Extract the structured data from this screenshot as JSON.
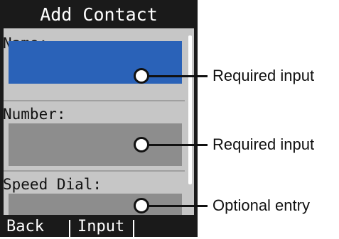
{
  "title": "Add Contact",
  "fields": [
    {
      "label": "Name:",
      "value": ""
    },
    {
      "label": "Number:",
      "value": ""
    },
    {
      "label": "Speed Dial:",
      "value": ""
    }
  ],
  "softkeys": {
    "back": "Back",
    "input": "Input",
    "third": ""
  },
  "callouts": [
    "Required input",
    "Required input",
    "Optional entry"
  ],
  "colors": {
    "selected_field": "#2a62b8",
    "field": "#8d8d8d",
    "panel": "#c6c6c6",
    "bar": "#1a1a1a"
  }
}
